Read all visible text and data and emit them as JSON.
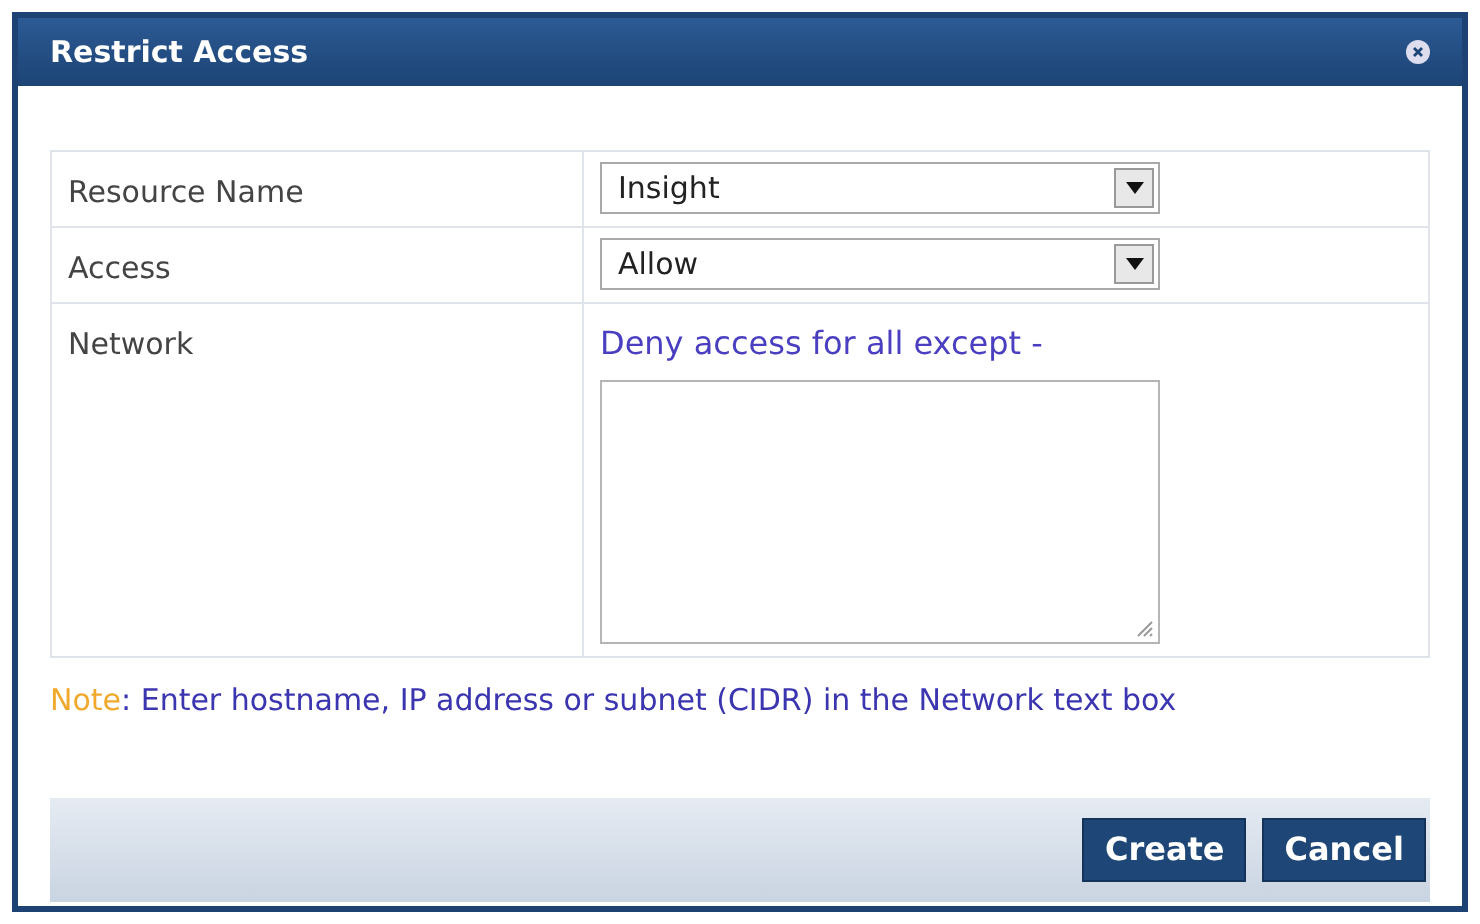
{
  "window": {
    "title": "Restrict Access"
  },
  "form": {
    "rows": [
      {
        "kind": "select",
        "label": "Resource Name",
        "value": "Insight"
      },
      {
        "kind": "select",
        "label": "Access",
        "value": "Allow"
      },
      {
        "kind": "textarea",
        "label": "Network",
        "hint": "Deny access for all except -"
      }
    ]
  },
  "note": {
    "label": "Note",
    "text": ": Enter hostname, IP address or subnet (CIDR) in the Network text box"
  },
  "buttons": [
    "Create",
    "Cancel"
  ]
}
